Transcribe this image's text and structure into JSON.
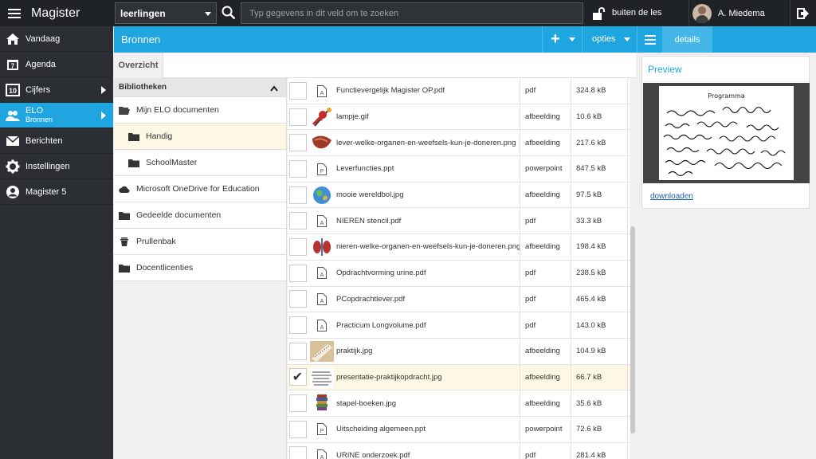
{
  "topbar": {
    "brand": "Magister",
    "context": "leerlingen",
    "search_placeholder": "Typ gegevens in dit veld om te zoeken",
    "lesson_status": "buiten de les",
    "user_name": "A. Miedema"
  },
  "sidebar": {
    "items": [
      {
        "label": "Vandaag",
        "icon": "home-icon"
      },
      {
        "label": "Agenda",
        "icon": "calendar-icon",
        "icon_text": "7"
      },
      {
        "label": "Cijfers",
        "icon": "grades-icon",
        "icon_text": "10"
      },
      {
        "label": "ELO",
        "sub": "Bronnen",
        "icon": "users-icon"
      },
      {
        "label": "Berichten",
        "icon": "mail-icon"
      },
      {
        "label": "Instellingen",
        "icon": "gear-icon"
      },
      {
        "label": "Magister 5",
        "icon": "user-circle-icon"
      }
    ]
  },
  "header": {
    "title": "Bronnen",
    "add_label": "+",
    "options_label": "opties",
    "details_label": "details"
  },
  "tabs": {
    "overzicht": "Overzicht"
  },
  "library": {
    "heading": "Bibliotheken",
    "items": [
      {
        "label": "Mijn ELO documenten",
        "icon": "folder-open-icon"
      },
      {
        "label": "Handig",
        "icon": "folder-icon"
      },
      {
        "label": "SchoolMaster",
        "icon": "folder-icon"
      },
      {
        "label": "Microsoft OneDrive for Education",
        "icon": "cloud-icon"
      },
      {
        "label": "Gedeelde documenten",
        "icon": "folder-icon"
      },
      {
        "label": "Prullenbak",
        "icon": "trash-icon"
      },
      {
        "label": "Docentlicenties",
        "icon": "folder-icon"
      }
    ]
  },
  "files": [
    {
      "name": "Functievergelijk Magister OP.pdf",
      "type": "pdf",
      "size": "324.8 kB",
      "icon": "pdf-icon"
    },
    {
      "name": "lampje.gif",
      "type": "afbeelding",
      "size": "10.6 kB",
      "icon": "image-thumb-icon"
    },
    {
      "name": "lever-welke-organen-en-weefsels-kun-je-doneren.png",
      "type": "afbeelding",
      "size": "217.6 kB",
      "icon": "image-thumb-icon"
    },
    {
      "name": "Leverfuncties.ppt",
      "type": "powerpoint",
      "size": "847.5 kB",
      "icon": "ppt-icon"
    },
    {
      "name": "mooie wereldbol.jpg",
      "type": "afbeelding",
      "size": "97.5 kB",
      "icon": "image-thumb-icon"
    },
    {
      "name": "NIEREN stencil.pdf",
      "type": "pdf",
      "size": "33.3 kB",
      "icon": "pdf-icon"
    },
    {
      "name": "nieren-welke-organen-en-weefsels-kun-je-doneren.png",
      "type": "afbeelding",
      "size": "198.4 kB",
      "icon": "image-thumb-icon"
    },
    {
      "name": "Opdrachtvorming urine.pdf",
      "type": "pdf",
      "size": "238.5 kB",
      "icon": "pdf-icon"
    },
    {
      "name": "PCopdrachtlever.pdf",
      "type": "pdf",
      "size": "465.4 kB",
      "icon": "pdf-icon"
    },
    {
      "name": "Practicum Longvolume.pdf",
      "type": "pdf",
      "size": "143.0 kB",
      "icon": "pdf-icon"
    },
    {
      "name": "praktijk.jpg",
      "type": "afbeelding",
      "size": "104.9 kB",
      "icon": "image-thumb-icon"
    },
    {
      "name": "presentatie-praktijkopdracht.jpg",
      "type": "afbeelding",
      "size": "66.7 kB",
      "icon": "image-thumb-icon",
      "checked": true
    },
    {
      "name": "stapel-boeken.jpg",
      "type": "afbeelding",
      "size": "35.6 kB",
      "icon": "image-thumb-icon"
    },
    {
      "name": "Uitscheiding algemeen.ppt",
      "type": "powerpoint",
      "size": "72.6 kB",
      "icon": "ppt-icon"
    },
    {
      "name": "URINE onderzoek.pdf",
      "type": "pdf",
      "size": "281.4 kB",
      "icon": "pdf-icon"
    }
  ],
  "preview": {
    "title": "Preview",
    "doc_title": "Programma",
    "download_label": "downloaden"
  },
  "colors": {
    "accent": "#1fa6e0",
    "dark": "#2b2f33",
    "selected_row": "#fcf8e3"
  }
}
